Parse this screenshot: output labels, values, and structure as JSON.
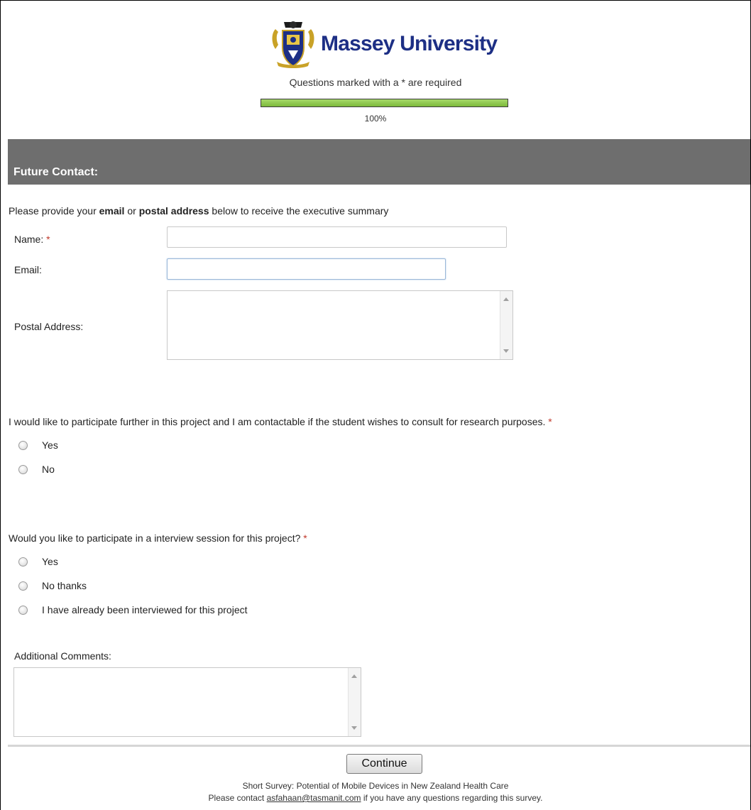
{
  "brand": {
    "name": "Massey University",
    "crest": "university-crest"
  },
  "header": {
    "required_note": "Questions marked with a * are required",
    "progress_percent": 100,
    "progress_text": "100%"
  },
  "section": {
    "title": "Future Contact:"
  },
  "intro": {
    "prefix": "Please provide your ",
    "email_bold": "email",
    "or": " or ",
    "postal_bold": "postal address",
    "suffix": " below to receive the executive summary"
  },
  "fields": {
    "name_label": "Name:",
    "name_value": "",
    "email_label": "Email:",
    "email_value": "",
    "postal_label": "Postal Address:",
    "postal_value": "",
    "required_marker": "*"
  },
  "q1": {
    "text": "I would like to participate further in this project and I am contactable if the student wishes to consult for research purposes.",
    "options": [
      "Yes",
      "No"
    ]
  },
  "q2": {
    "text": "Would you like to participate in a interview session for this project?",
    "options": [
      "Yes",
      "No thanks",
      "I have already been interviewed for this project"
    ]
  },
  "comments": {
    "label": "Additional Comments:",
    "value": ""
  },
  "actions": {
    "continue_label": "Continue"
  },
  "footer": {
    "survey_title": "Short Survey: Potential of Mobile Devices in New Zealand Health Care",
    "contact_prefix": "Please contact ",
    "contact_email": "asfahaan@tasmanit.com",
    "contact_suffix": " if you have any questions regarding this survey."
  },
  "colors": {
    "brand_blue": "#1d2f85",
    "section_bar": "#6e6e6e",
    "progress_green": "#8cc63f",
    "required_red": "#c0392b"
  }
}
